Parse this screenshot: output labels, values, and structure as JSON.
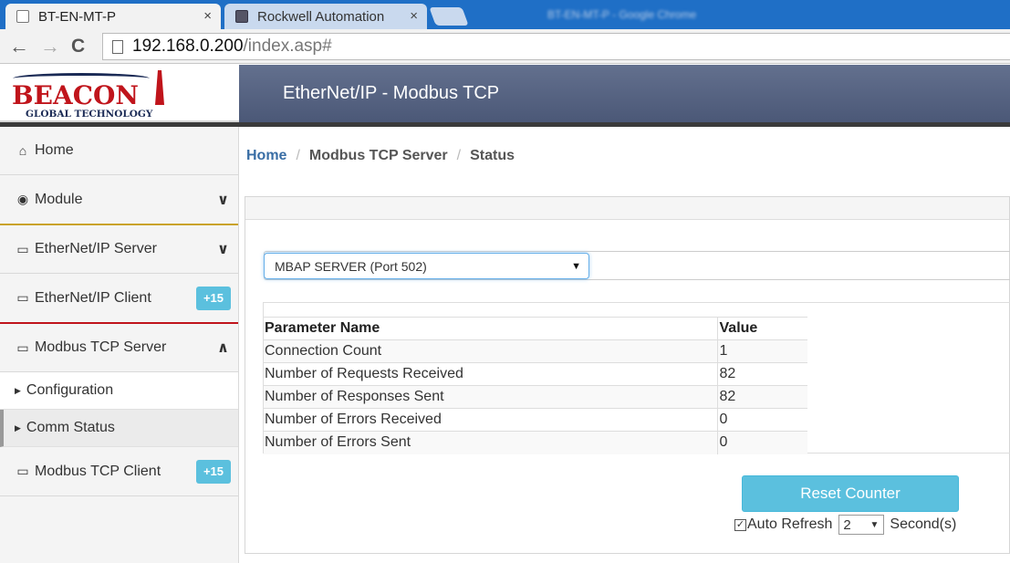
{
  "browser": {
    "tabs": [
      {
        "title": "BT-EN-MT-P",
        "close": "×"
      },
      {
        "title": "Rockwell Automation",
        "close": "×"
      }
    ],
    "window_title": "BT-EN-MT-P - Google Chrome",
    "url_host": "192.168.0.200",
    "url_path": "/index.asp#",
    "nav": {
      "back": "←",
      "forward": "→",
      "reload": "C"
    }
  },
  "logo": {
    "name": "BEACON",
    "tagline": "GLOBAL TECHNOLOGY"
  },
  "header": {
    "title": "EtherNet/IP - Modbus TCP"
  },
  "sidebar": {
    "items": [
      {
        "label": "Home",
        "icon": "home-icon",
        "glyph": "⌂"
      },
      {
        "label": "Module",
        "icon": "dashboard-icon",
        "glyph": "◉",
        "chevron": "∨"
      },
      {
        "label": "EtherNet/IP Server",
        "icon": "inbox-icon",
        "glyph": "▭",
        "chevron": "∨"
      },
      {
        "label": "EtherNet/IP Client",
        "icon": "monitor-icon",
        "glyph": "▭",
        "badge": "+15"
      },
      {
        "label": "Modbus TCP Server",
        "icon": "inbox-icon",
        "glyph": "▭",
        "chevron": "∧"
      },
      {
        "label": "Modbus TCP Client",
        "icon": "monitor-icon",
        "glyph": "▭",
        "badge": "+15"
      }
    ],
    "sub_items": [
      {
        "label": "Configuration"
      },
      {
        "label": "Comm Status"
      }
    ],
    "accent_colors": {
      "module_divider": "#c9a227",
      "client_divider": "#c0141b"
    }
  },
  "breadcrumb": {
    "home": "Home",
    "section": "Modbus TCP Server",
    "page": "Status",
    "sep": "/"
  },
  "main": {
    "server_select": {
      "value": "MBAP SERVER (Port 502)"
    },
    "table": {
      "headers": [
        "Parameter Name",
        "Value"
      ],
      "rows": [
        [
          "Connection Count",
          "1"
        ],
        [
          "Number of Requests Received",
          "82"
        ],
        [
          "Number of Responses Sent",
          "82"
        ],
        [
          "Number of Errors Received",
          "0"
        ],
        [
          "Number of Errors Sent",
          "0"
        ]
      ]
    },
    "reset_label": "Reset Counter",
    "auto_refresh": {
      "label": "Auto Refresh",
      "checked": true,
      "interval": "2",
      "unit": "Second(s)"
    }
  },
  "colors": {
    "header_bg": "#56637f",
    "accent": "#5bc0de",
    "link": "#3a6ea5"
  }
}
